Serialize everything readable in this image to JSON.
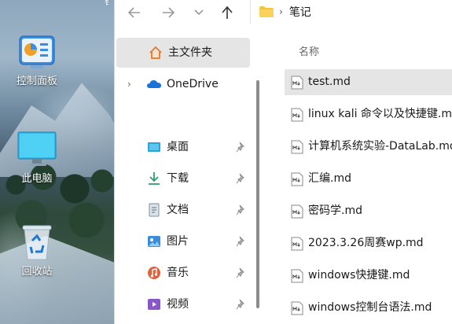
{
  "desktop": {
    "icons": [
      {
        "label": "控制面板",
        "icon": "control-panel-icon"
      },
      {
        "label": "此电脑",
        "icon": "monitor-icon"
      },
      {
        "label": "回收站",
        "icon": "recycle-bin-icon"
      }
    ]
  },
  "explorer": {
    "toolbar": {
      "back": "back-arrow-icon",
      "forward": "forward-arrow-icon",
      "recent": "chevron-down-icon",
      "up": "up-arrow-icon"
    },
    "address": {
      "folder_icon": "folder-icon",
      "path": "笔记"
    },
    "sidebar": {
      "items": [
        {
          "label": "主文件夹",
          "icon": "home-icon",
          "selected": true
        },
        {
          "label": "OneDrive",
          "icon": "onedrive-cloud-icon",
          "expandable": true
        },
        {
          "label": "桌面",
          "icon": "desktop-icon",
          "pinned": true
        },
        {
          "label": "下载",
          "icon": "download-icon",
          "pinned": true
        },
        {
          "label": "文档",
          "icon": "document-icon",
          "pinned": true
        },
        {
          "label": "图片",
          "icon": "pictures-icon",
          "pinned": true
        },
        {
          "label": "音乐",
          "icon": "music-icon",
          "pinned": true
        },
        {
          "label": "视频",
          "icon": "video-icon",
          "pinned": true
        }
      ]
    },
    "files": {
      "column_name": "名称",
      "items": [
        {
          "name": "test.md",
          "selected": true
        },
        {
          "name": "linux kali 命令以及快捷键.md"
        },
        {
          "name": "计算机系统实验-DataLab.md"
        },
        {
          "name": "汇编.md"
        },
        {
          "name": "密码学.md"
        },
        {
          "name": "2023.3.26周赛wp.md"
        },
        {
          "name": "windows快捷键.md"
        },
        {
          "name": "windows控制台语法.md"
        }
      ]
    }
  },
  "colors": {
    "selection": "#e5e5e5",
    "folder": "#f5c542",
    "onedrive": "#1a73d9",
    "home": "#e07a2e"
  }
}
